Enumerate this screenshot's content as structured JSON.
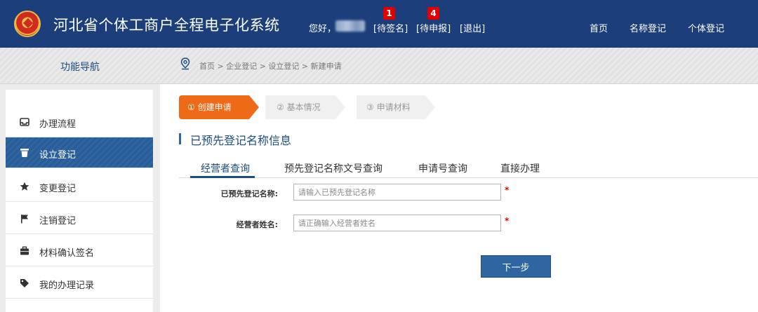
{
  "header": {
    "title": "河北省个体工商户全程电子化系统",
    "greeting": "您好，",
    "links": {
      "pending_sign": "[待签名]",
      "pending_sign_count": "1",
      "pending_submit": "[待申报]",
      "pending_submit_count": "4",
      "logout": "[退出]"
    },
    "nav": [
      "首页",
      "名称登记",
      "个体登记"
    ]
  },
  "sidebar": {
    "heading": "功能导航",
    "items": [
      {
        "label": "办理流程",
        "icon": "tray-icon"
      },
      {
        "label": "设立登记",
        "icon": "trash-icon",
        "active": true
      },
      {
        "label": "变更登记",
        "icon": "star-icon"
      },
      {
        "label": "注销登记",
        "icon": "flag-icon"
      },
      {
        "label": "材料确认签名",
        "icon": "briefcase-icon"
      },
      {
        "label": "我的办理记录",
        "icon": "tag-icon"
      }
    ]
  },
  "breadcrumb": "首页 > 企业登记 > 设立登记 > 新建申请",
  "steps": [
    "① 创建申请",
    "② 基本情况",
    "③ 申请材料"
  ],
  "section_title": "已预先登记名称信息",
  "tabs": [
    "经营者查询",
    "预先登记名称文号查询",
    "申请号查询",
    "直接办理"
  ],
  "form": {
    "name_label": "已预先登记名称:",
    "name_placeholder": "请输入已预先登记名称",
    "operator_label": "经营者姓名:",
    "operator_placeholder": "请正确输入经营者姓名",
    "required_mark": "*"
  },
  "next_button": "下一步",
  "colors": {
    "header_bg": "#1c3e7a",
    "accent_blue": "#2f65a1",
    "step_active": "#ee6a16",
    "required": "#e00000"
  }
}
